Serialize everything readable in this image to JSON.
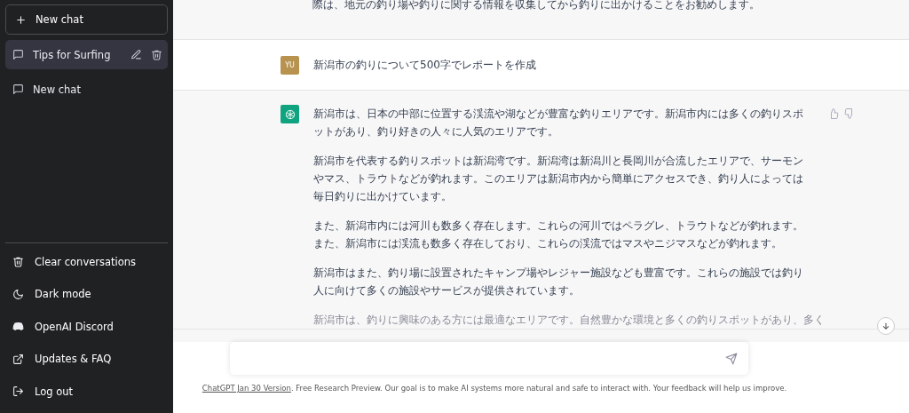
{
  "sidebar": {
    "new_chat": "New chat",
    "history": [
      {
        "title": "Tips for Surfing",
        "selected": true
      },
      {
        "title": "New chat",
        "selected": false
      }
    ],
    "menu": [
      {
        "label": "Clear conversations",
        "kind": "trash"
      },
      {
        "label": "Dark mode",
        "kind": "moon"
      },
      {
        "label": "OpenAI Discord",
        "kind": "discord"
      },
      {
        "label": "Updates & FAQ",
        "kind": "external"
      },
      {
        "label": "Log out",
        "kind": "logout"
      }
    ]
  },
  "messages": [
    {
      "kind": "assistant",
      "feedback": false,
      "paragraphs": [
        "際は、地元の釣り場や釣りに関する情報を収集してから釣りに出かけることをお勧めします。"
      ]
    },
    {
      "kind": "user",
      "avatar": "YU",
      "paragraphs": [
        "新潟市の釣りについて500字でレポートを作成"
      ]
    },
    {
      "kind": "assistant",
      "feedback": true,
      "paragraphs": [
        "新潟市は、日本の中部に位置する渓流や湖などが豊富な釣りエリアです。新潟市内には多くの釣りスポットがあり、釣り好きの人々に人気のエリアです。",
        "新潟市を代表する釣りスポットは新潟湾です。新潟湾は新潟川と長岡川が合流したエリアで、サーモンやマス、トラウトなどが釣れます。このエリアは新潟市内から簡単にアクセスでき、釣り人によっては毎日釣りに出かけています。",
        "また、新潟市内には河川も数多く存在します。これらの河川ではペラグレ、トラウトなどが釣れます。また、新潟市には渓流も数多く存在しており、これらの渓流ではマスやニジマスなどが釣れます。",
        "新潟市はまた、釣り場に設置されたキャンプ場やレジャー施設なども豊富です。これらの施設では釣り人に向けて多くの施設やサービスが提供されています。",
        "新潟市は、釣りに興味のある方には最適なエリアです。自然豊かな環境と多くの釣りスポットがあり、多く"
      ]
    }
  ],
  "footer": {
    "link": "ChatGPT Jan 30 Version",
    "text": ". Free Research Preview. Our goal is to make AI systems more natural and safe to interact with. Your feedback will help us improve."
  }
}
